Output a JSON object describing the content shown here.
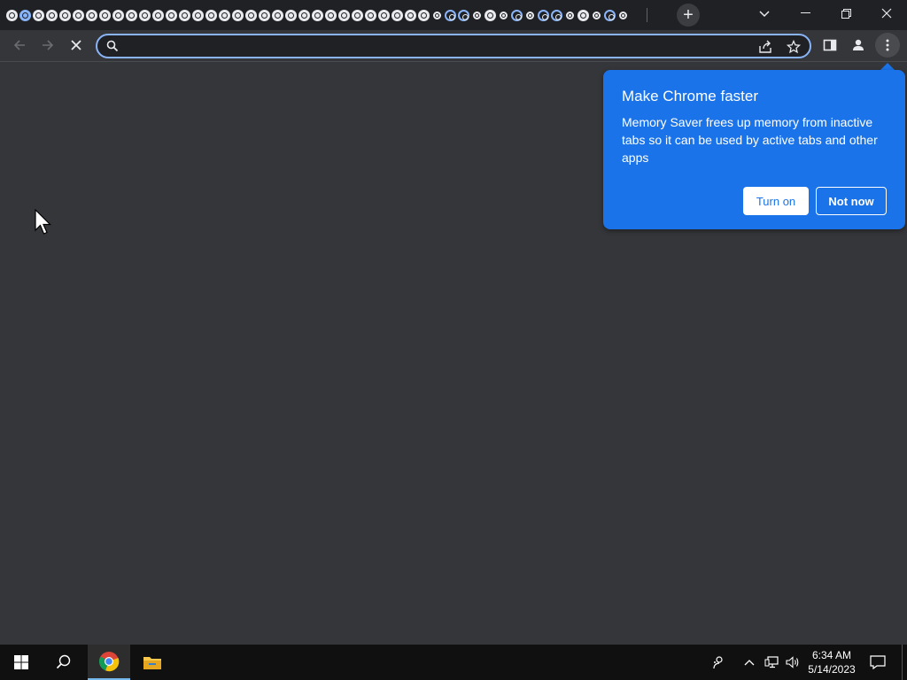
{
  "browser": {
    "tab_count_visible": 47,
    "new_tab_label": "+",
    "omnibox": {
      "value": "",
      "placeholder": ""
    }
  },
  "popup": {
    "title": "Make Chrome faster",
    "body": "Memory Saver frees up memory from inactive tabs so it can be used by active tabs and other apps",
    "primary_button": "Turn on",
    "secondary_button": "Not now",
    "color": "#1a73e8"
  },
  "taskbar": {
    "time": "6:34 AM",
    "date": "5/14/2023",
    "icons": [
      "windows-start-icon",
      "search-icon",
      "chrome-icon",
      "file-explorer-icon",
      "people-icon",
      "tray-chevron-icon",
      "network-icon",
      "volume-icon",
      "notification-icon"
    ]
  },
  "colors": {
    "tabstrip": "#202124",
    "toolbar": "#35363a",
    "accent": "#8ab4f8",
    "taskbar": "#101010"
  }
}
